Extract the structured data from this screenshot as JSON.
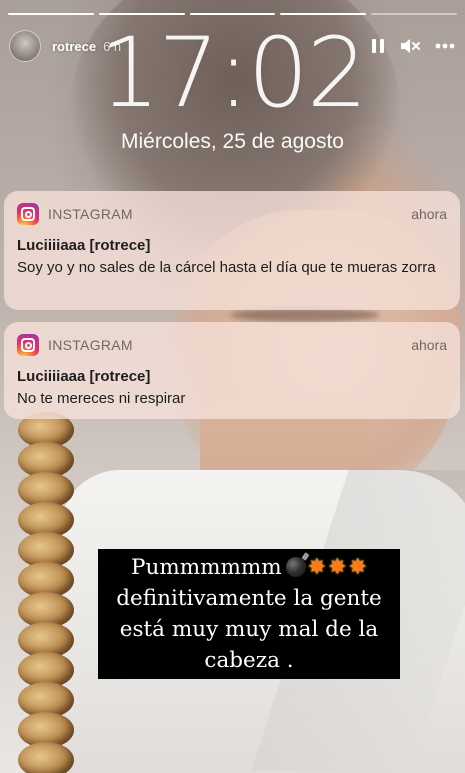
{
  "story": {
    "progress": [
      1,
      1,
      1,
      1,
      0
    ],
    "username": "rotrece",
    "time_ago": "6 h",
    "actions": [
      "pause-icon",
      "mute-icon",
      "more-options-icon"
    ]
  },
  "lockscreen": {
    "time": "17:02",
    "date": "Miércoles, 25 de agosto"
  },
  "notifications": [
    {
      "app": "INSTAGRAM",
      "time": "ahora",
      "title": "Luciiiiaaa [rotrece]",
      "body": "Soy yo y no sales de la cárcel hasta el día que te mueras zorra"
    },
    {
      "app": "INSTAGRAM",
      "time": "ahora",
      "title": "Luciiiiaaa [rotrece]",
      "body": "No te mereces ni respirar"
    }
  ],
  "caption": {
    "lines": [
      "Pummmmmm",
      "definitivamente la gente",
      "está muy muy mal de la",
      "cabeza ."
    ],
    "emojis": [
      "bomb-icon",
      "collision-icon",
      "collision-icon",
      "collision-icon"
    ]
  },
  "colors": {
    "notification_bg": "#f6e2da",
    "caption_bg": "#000000",
    "caption_text": "#ffffff"
  }
}
